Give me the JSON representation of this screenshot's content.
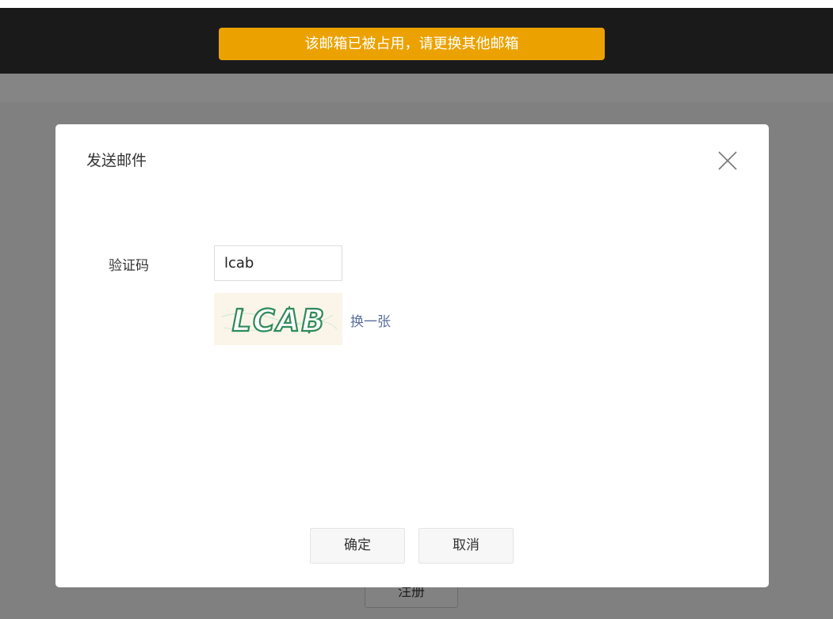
{
  "toast": {
    "message": "该邮箱已被占用，请更换其他邮箱",
    "color": "#eba200"
  },
  "background": {
    "register_button_label": "注册"
  },
  "dialog": {
    "title": "发送邮件",
    "close_icon": "close-icon",
    "captcha": {
      "label": "验证码",
      "value": "lcab",
      "image_text": "LCAB",
      "refresh_label": "换一张"
    },
    "buttons": {
      "confirm_label": "确定",
      "cancel_label": "取消"
    }
  }
}
